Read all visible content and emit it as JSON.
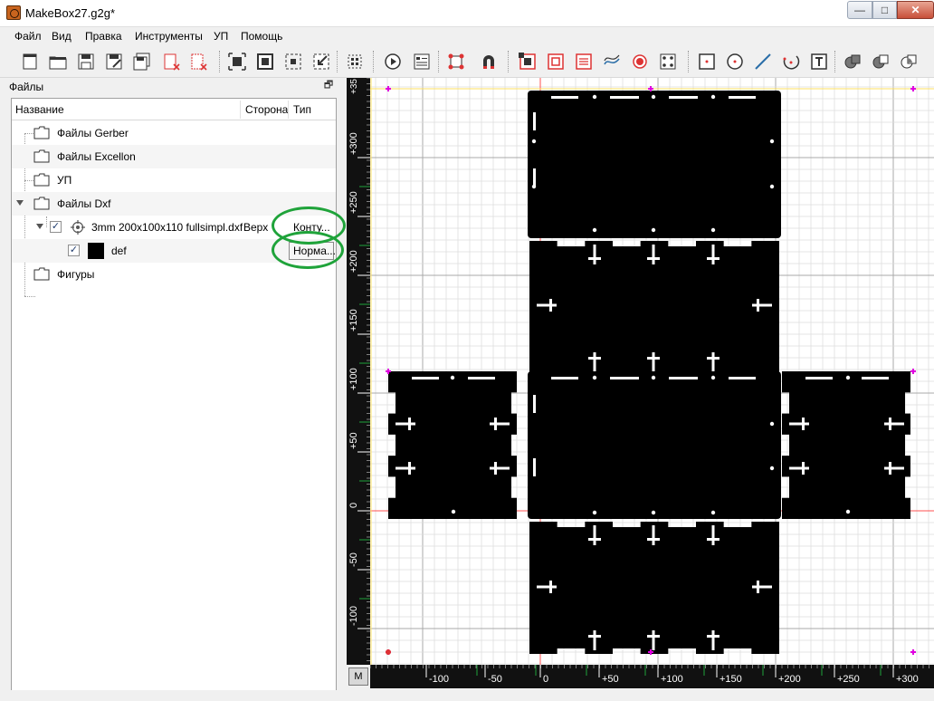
{
  "window": {
    "title": "MakeBox27.g2g*",
    "minimize_glyph": "—",
    "maximize_glyph": "□",
    "close_glyph": "✕"
  },
  "menu": [
    "Файл",
    "Вид",
    "Правка",
    "Инструменты",
    "УП",
    "Помощь"
  ],
  "toolbar_icons": [
    "new-file-icon",
    "open-folder-icon",
    "save-icon",
    "save-as-icon",
    "save-all-icon",
    "close-file-icon",
    "close-all-icon",
    "zoom-fit-icon",
    "zoom-100-icon",
    "zoom-selection-icon",
    "zoom-to-icon",
    "select-all-icon",
    "run-icon",
    "properties-icon",
    "pcb-board-icon",
    "magnet-icon",
    "pocket-offset-icon",
    "pocket-raster-icon",
    "hatching-icon",
    "profile-icon",
    "voronoi-icon",
    "drilling-icon",
    "rectangle-icon",
    "circle-icon",
    "line-icon",
    "arc-icon",
    "text-icon",
    "union-icon",
    "subtract-icon",
    "intersect-icon"
  ],
  "panel": {
    "title": "Файлы",
    "float_glyph": "🗗",
    "columns": {
      "name": "Название",
      "side": "Сторона",
      "type": "Тип"
    },
    "rows": [
      {
        "label": "Файлы Gerber"
      },
      {
        "label": "Файлы Excellon"
      },
      {
        "label": "УП"
      },
      {
        "label": "Файлы Dxf"
      },
      {
        "label": "3mm 200x100x110 fullsimpl.dxf",
        "side": "Верх",
        "type": "Конту...",
        "checked": "✓"
      },
      {
        "label": "def",
        "type": "Норма...",
        "checked": "✓"
      },
      {
        "label": "Фигуры"
      }
    ]
  },
  "canvas": {
    "m_label": "M",
    "accent_red": "#ff5050",
    "grid_color": "#d0d0d0",
    "x_ticks": [
      "-100",
      "-50",
      "0",
      "+50",
      "+100",
      "+150",
      "+200",
      "+250",
      "+300"
    ],
    "y_ticks": [
      "+300",
      "+250",
      "+200",
      "+150",
      "+100",
      "+50",
      "0",
      "-50",
      "-100"
    ],
    "y_top_label": "+35"
  },
  "colors": {
    "annotation_green": "#1fa33a",
    "part_fill": "#000000",
    "marker_magenta": "#e000e0"
  }
}
